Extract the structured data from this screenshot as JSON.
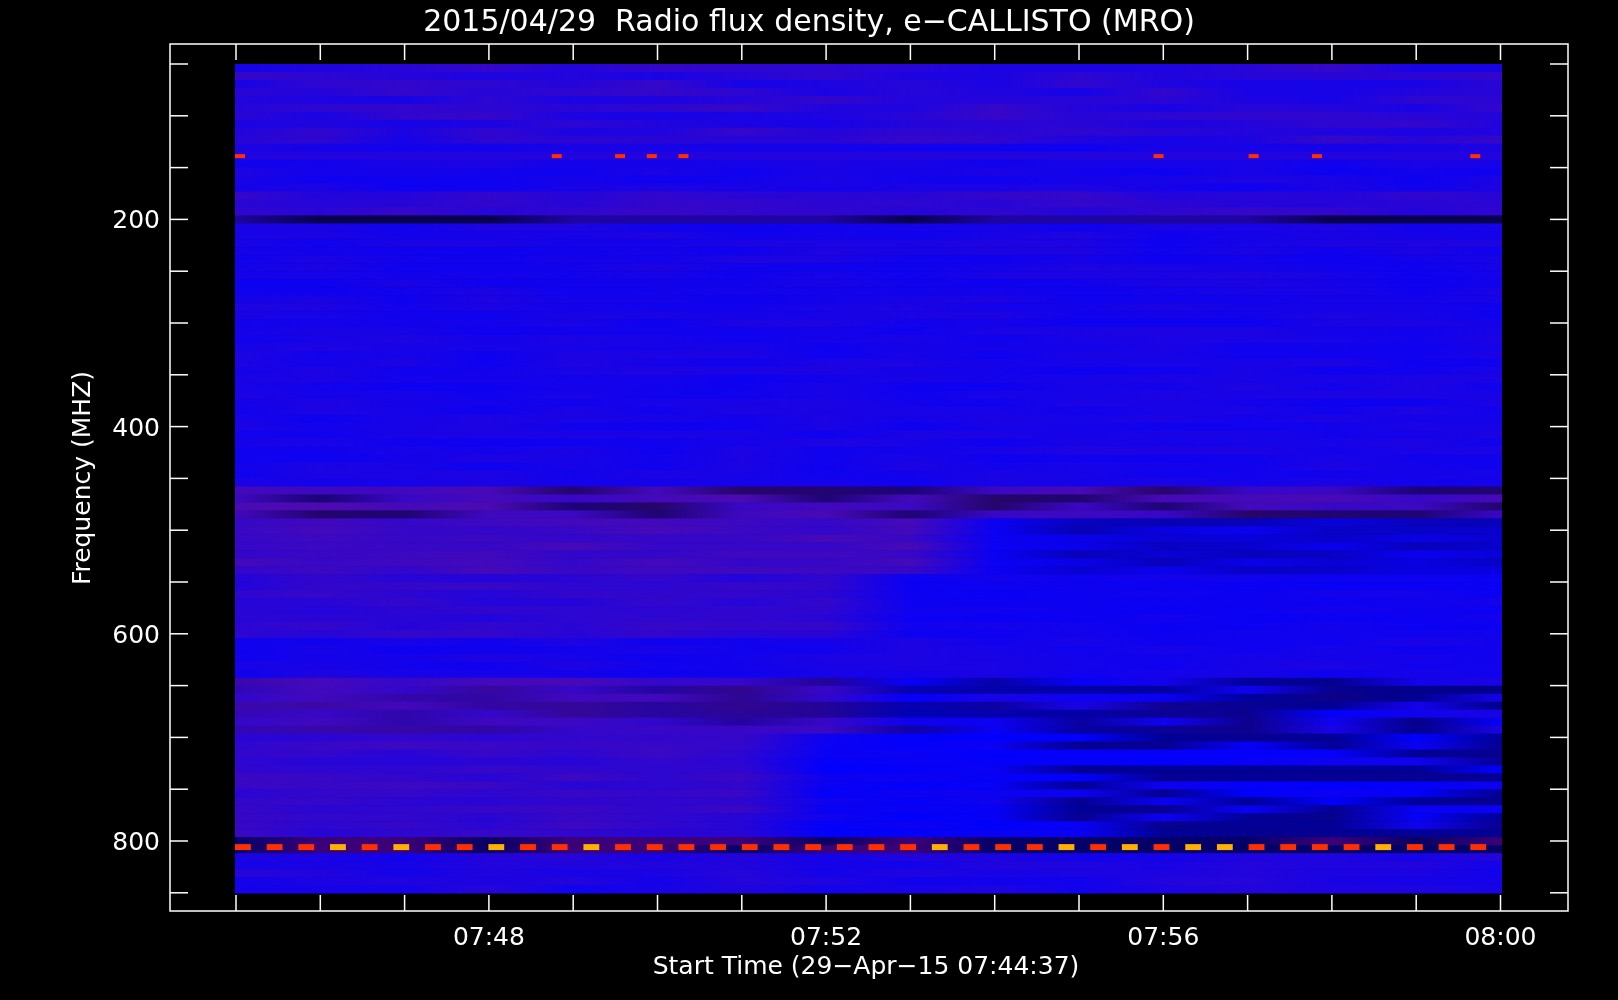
{
  "title": "2015/04/29  Radio flux density, e−CALLISTO (MRO)",
  "y_axis": {
    "label": "Frequency (MHZ)",
    "ticks": [
      "200",
      "400",
      "600",
      "800"
    ]
  },
  "x_axis": {
    "label": "Start Time (29−Apr−15 07:44:37)",
    "ticks": [
      "07:48",
      "07:52",
      "07:56",
      "08:00"
    ]
  }
}
